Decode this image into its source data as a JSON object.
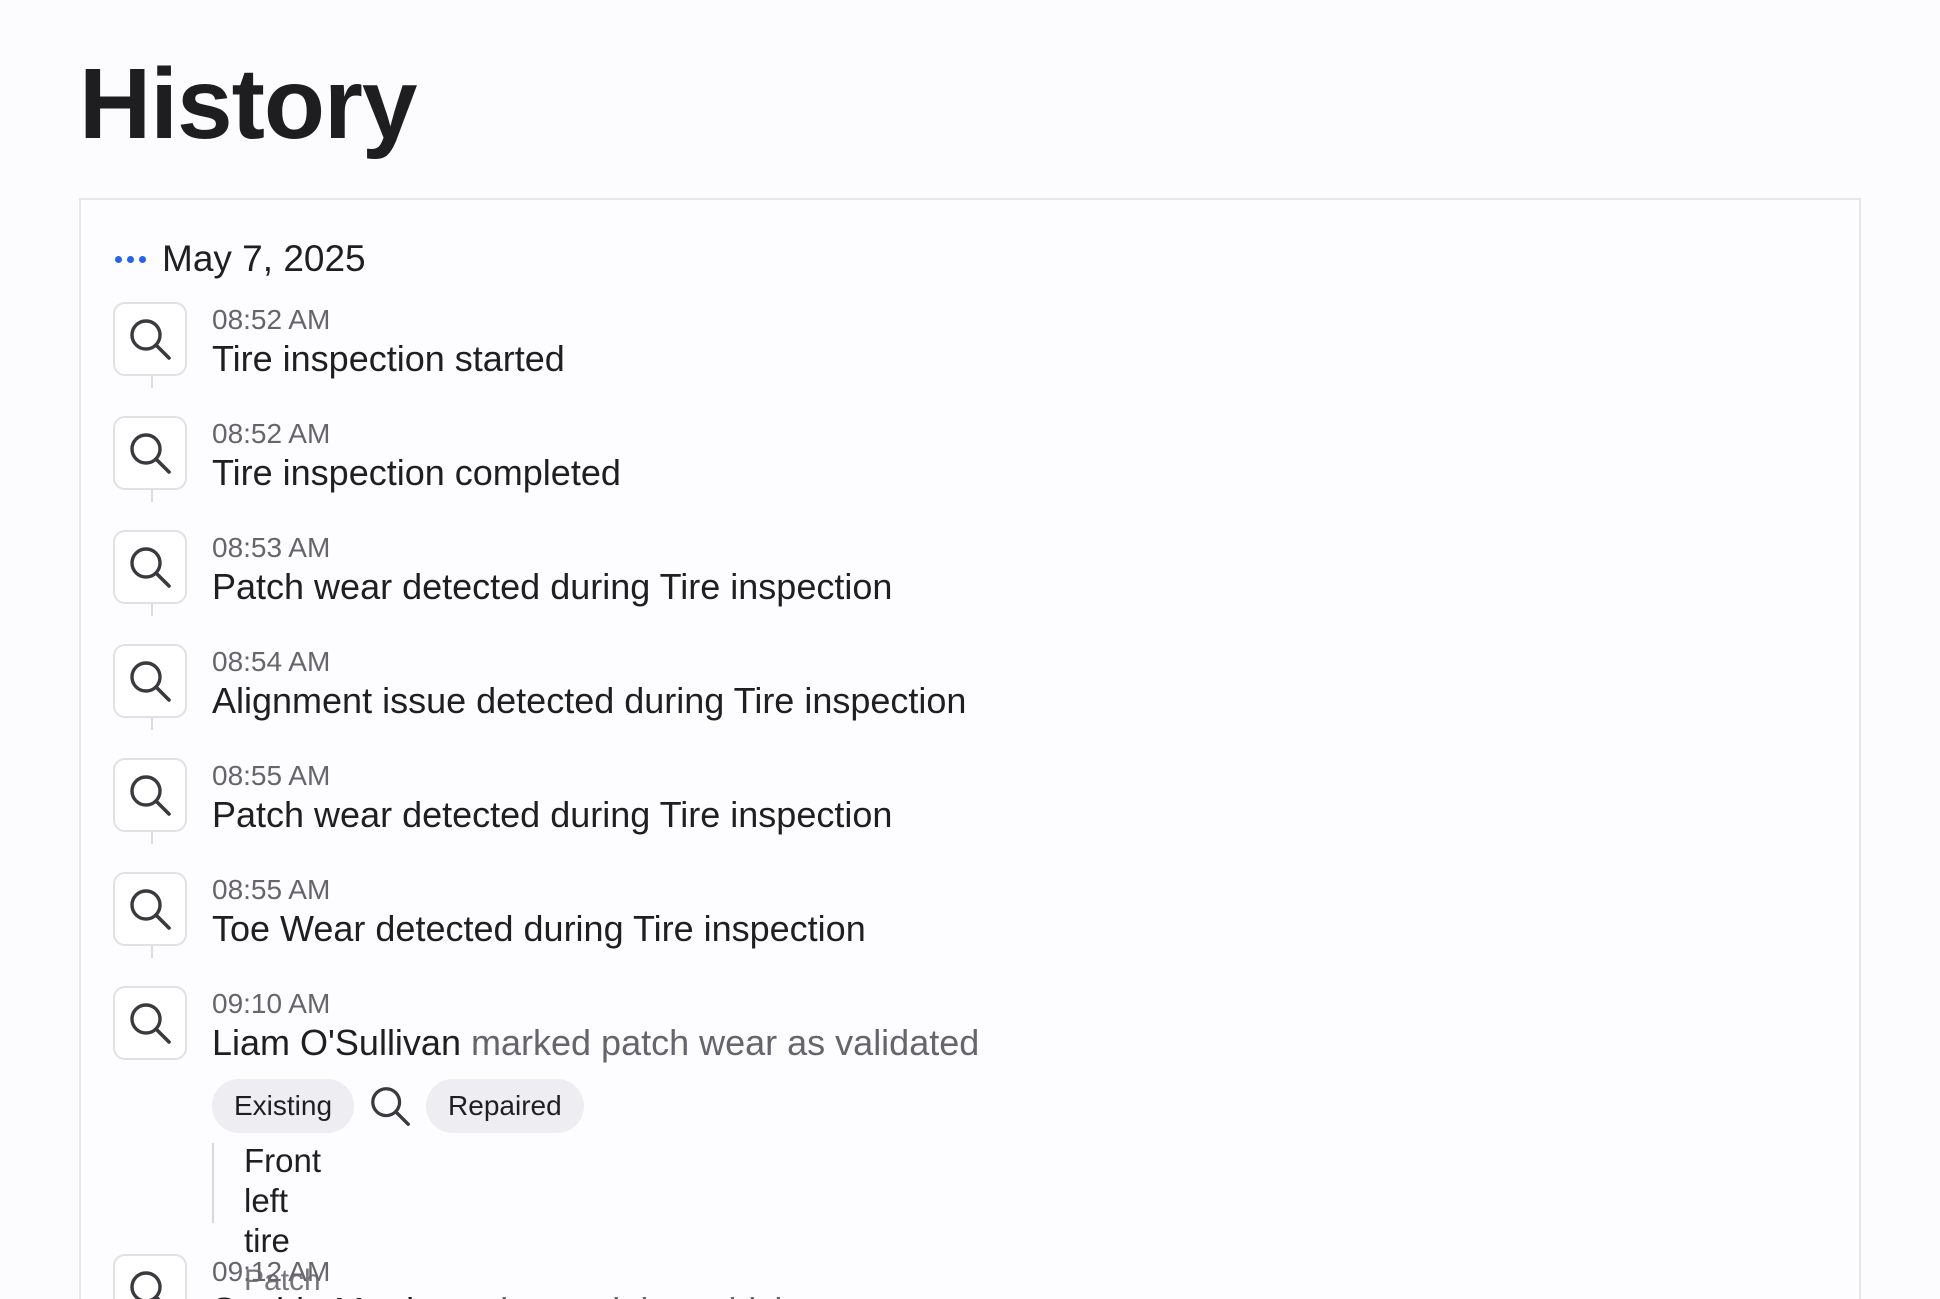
{
  "page": {
    "title": "History"
  },
  "history": {
    "date": "May 7, 2025",
    "entries": [
      {
        "time": "08:52 AM",
        "text": "Tire inspection started",
        "icon": "search-icon"
      },
      {
        "time": "08:52 AM",
        "text": "Tire inspection completed",
        "icon": "search-icon"
      },
      {
        "time": "08:53 AM",
        "text": "Patch wear detected during Tire inspection",
        "icon": "search-icon"
      },
      {
        "time": "08:54 AM",
        "text": "Alignment issue detected during Tire inspection",
        "icon": "search-icon"
      },
      {
        "time": "08:55 AM",
        "text": "Patch wear detected during Tire inspection",
        "icon": "search-icon"
      },
      {
        "time": "08:55 AM",
        "text": "Toe Wear detected during Tire inspection",
        "icon": "search-icon"
      },
      {
        "time": "09:10 AM",
        "actor": "Liam O'Sullivan",
        "action": "marked patch wear as validated",
        "icon": "search-icon",
        "chips": {
          "from": "Existing",
          "to": "Repaired"
        },
        "detail": {
          "title": "Front left tire",
          "subtitle": "Patch wear"
        }
      },
      {
        "time": "09:12 AM",
        "actor": "Sophie Martinez",
        "action": "changed the vehicle status",
        "icon": "search-icon"
      }
    ]
  },
  "colors": {
    "accent": "#2563eb",
    "text_primary": "#1f1f21",
    "text_muted": "#66656b",
    "chip_bg": "#eeedf1",
    "border": "#e1e0e4"
  }
}
